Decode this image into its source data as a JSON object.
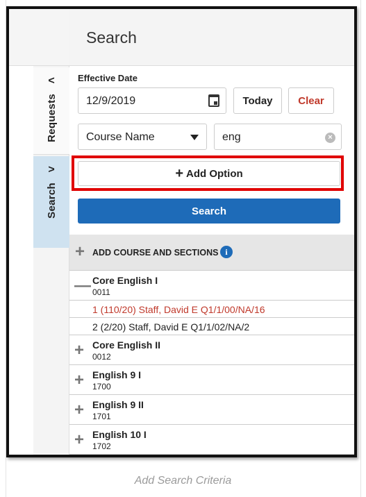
{
  "rail": {
    "tabs": [
      {
        "label": "Requests",
        "chevron": "<"
      },
      {
        "label": "Search",
        "chevron": ">"
      }
    ]
  },
  "panel": {
    "title": "Search",
    "effective_date_label": "Effective Date",
    "date_value": "12/9/2019",
    "today_label": "Today",
    "clear_label": "Clear",
    "filter_field": "Course Name",
    "search_text": "eng",
    "clear_icon_glyph": "×",
    "add_option_plus": "+",
    "add_option_label": "Add Option",
    "search_button_label": "Search",
    "add_course_label": "ADD COURSE AND SECTIONS",
    "info_glyph": "i"
  },
  "courses": [
    {
      "toggle": "—",
      "name": "Core English I",
      "number": "0011"
    },
    {
      "toggle": "+",
      "name": "Core English II",
      "number": "0012"
    },
    {
      "toggle": "+",
      "name": "English 9 I",
      "number": "1700"
    },
    {
      "toggle": "+",
      "name": "English 9 II",
      "number": "1701"
    },
    {
      "toggle": "+",
      "name": "English 10 I",
      "number": "1702"
    }
  ],
  "sections": [
    {
      "text": "1 (110/20) Staff, David E  Q1/1/00/NA/16",
      "status_color": "#c0392b"
    },
    {
      "text": "2 (2/20) Staff, David E  Q1/1/02/NA/2",
      "status_color": "#222222"
    }
  ],
  "caption": "Add Search Criteria",
  "colors": {
    "accent": "#1e6bb8",
    "highlight": "#e00000",
    "clear": "#c0392b",
    "active_tab": "#cfe2f0"
  }
}
